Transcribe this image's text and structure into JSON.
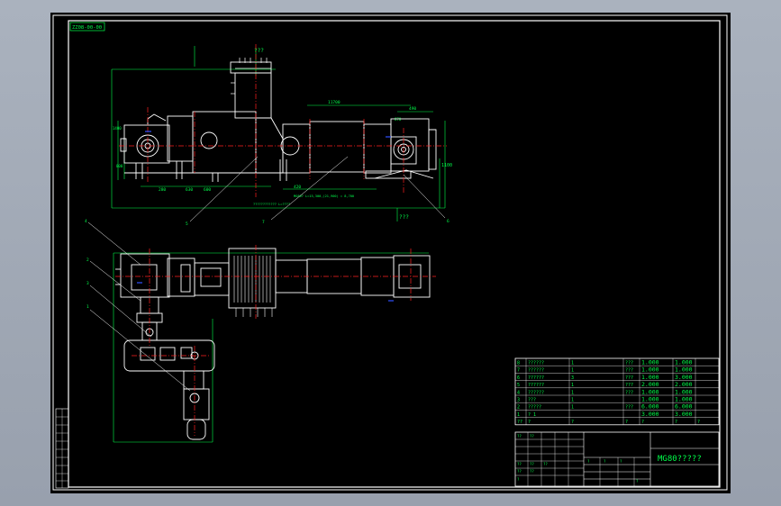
{
  "drawing": {
    "code_stamp": "ZZ08-00-00",
    "elevation_label_top": "???",
    "elevation_label_bottom": "???",
    "center_label": "?",
    "dims": {
      "d_total": "1400",
      "d_head_w": "800",
      "d_tail_w": "870",
      "d_1": "280",
      "d_2": "630",
      "d_3": "600",
      "d_4": "420",
      "d_5": "1100",
      "d_top1": "11700",
      "d_top2": "490",
      "d_long": "MG80?  L=15,300,(21,900) = 8,700",
      "d_total_bottom": "???????????? L=????"
    },
    "balloons": [
      "4",
      "2",
      "3",
      "1",
      "5",
      "6",
      "7",
      "8"
    ],
    "side_strip": [
      "??",
      "??",
      "??",
      "??",
      "??",
      "??",
      "??",
      "??",
      "??",
      "??"
    ]
  },
  "bom": {
    "rows": [
      {
        "no": "8",
        "name": "??????",
        "qty": "1",
        "mat": "???",
        "w1": "1.000",
        "w2": "1.000"
      },
      {
        "no": "7",
        "name": "??????",
        "qty": "1",
        "mat": "???",
        "w1": "1.000",
        "w2": "1.000"
      },
      {
        "no": "6",
        "name": "??????",
        "qty": "3",
        "mat": "???",
        "w1": "1.000",
        "w2": "3.000"
      },
      {
        "no": "5",
        "name": "??????",
        "qty": "1",
        "mat": "???",
        "w1": "2.000",
        "w2": "2.000"
      },
      {
        "no": "4",
        "name": "??????",
        "qty": "1",
        "mat": "???",
        "w1": "1.000",
        "w2": "1.000"
      },
      {
        "no": "3",
        "name": "???",
        "qty": "1",
        "mat": "",
        "w1": "1.000",
        "w2": "1.000"
      },
      {
        "no": "2",
        "name": "?????",
        "qty": "1",
        "mat": "???",
        "w1": "6.000",
        "w2": "6.000"
      },
      {
        "no": "1",
        "name": "?  1",
        "qty": "",
        "mat": "",
        "w1": "3.000",
        "w2": "3.000"
      }
    ],
    "header": [
      "??",
      "?",
      "?",
      "?",
      "?",
      "?",
      "?"
    ]
  },
  "title_block": {
    "drawing_name": "MG80?????",
    "small_cells": [
      "??",
      "??",
      "??",
      "??",
      "??",
      "??",
      "??",
      "?",
      "?",
      "?",
      "?",
      "?"
    ]
  },
  "colors": {
    "background": "#000000",
    "line_white": "#ffffff",
    "line_green": "#00ff4a",
    "line_cyan": "#00e5ff",
    "line_red": "#ff2020",
    "line_blue": "#3050ff",
    "line_yellow": "#ffff66"
  }
}
